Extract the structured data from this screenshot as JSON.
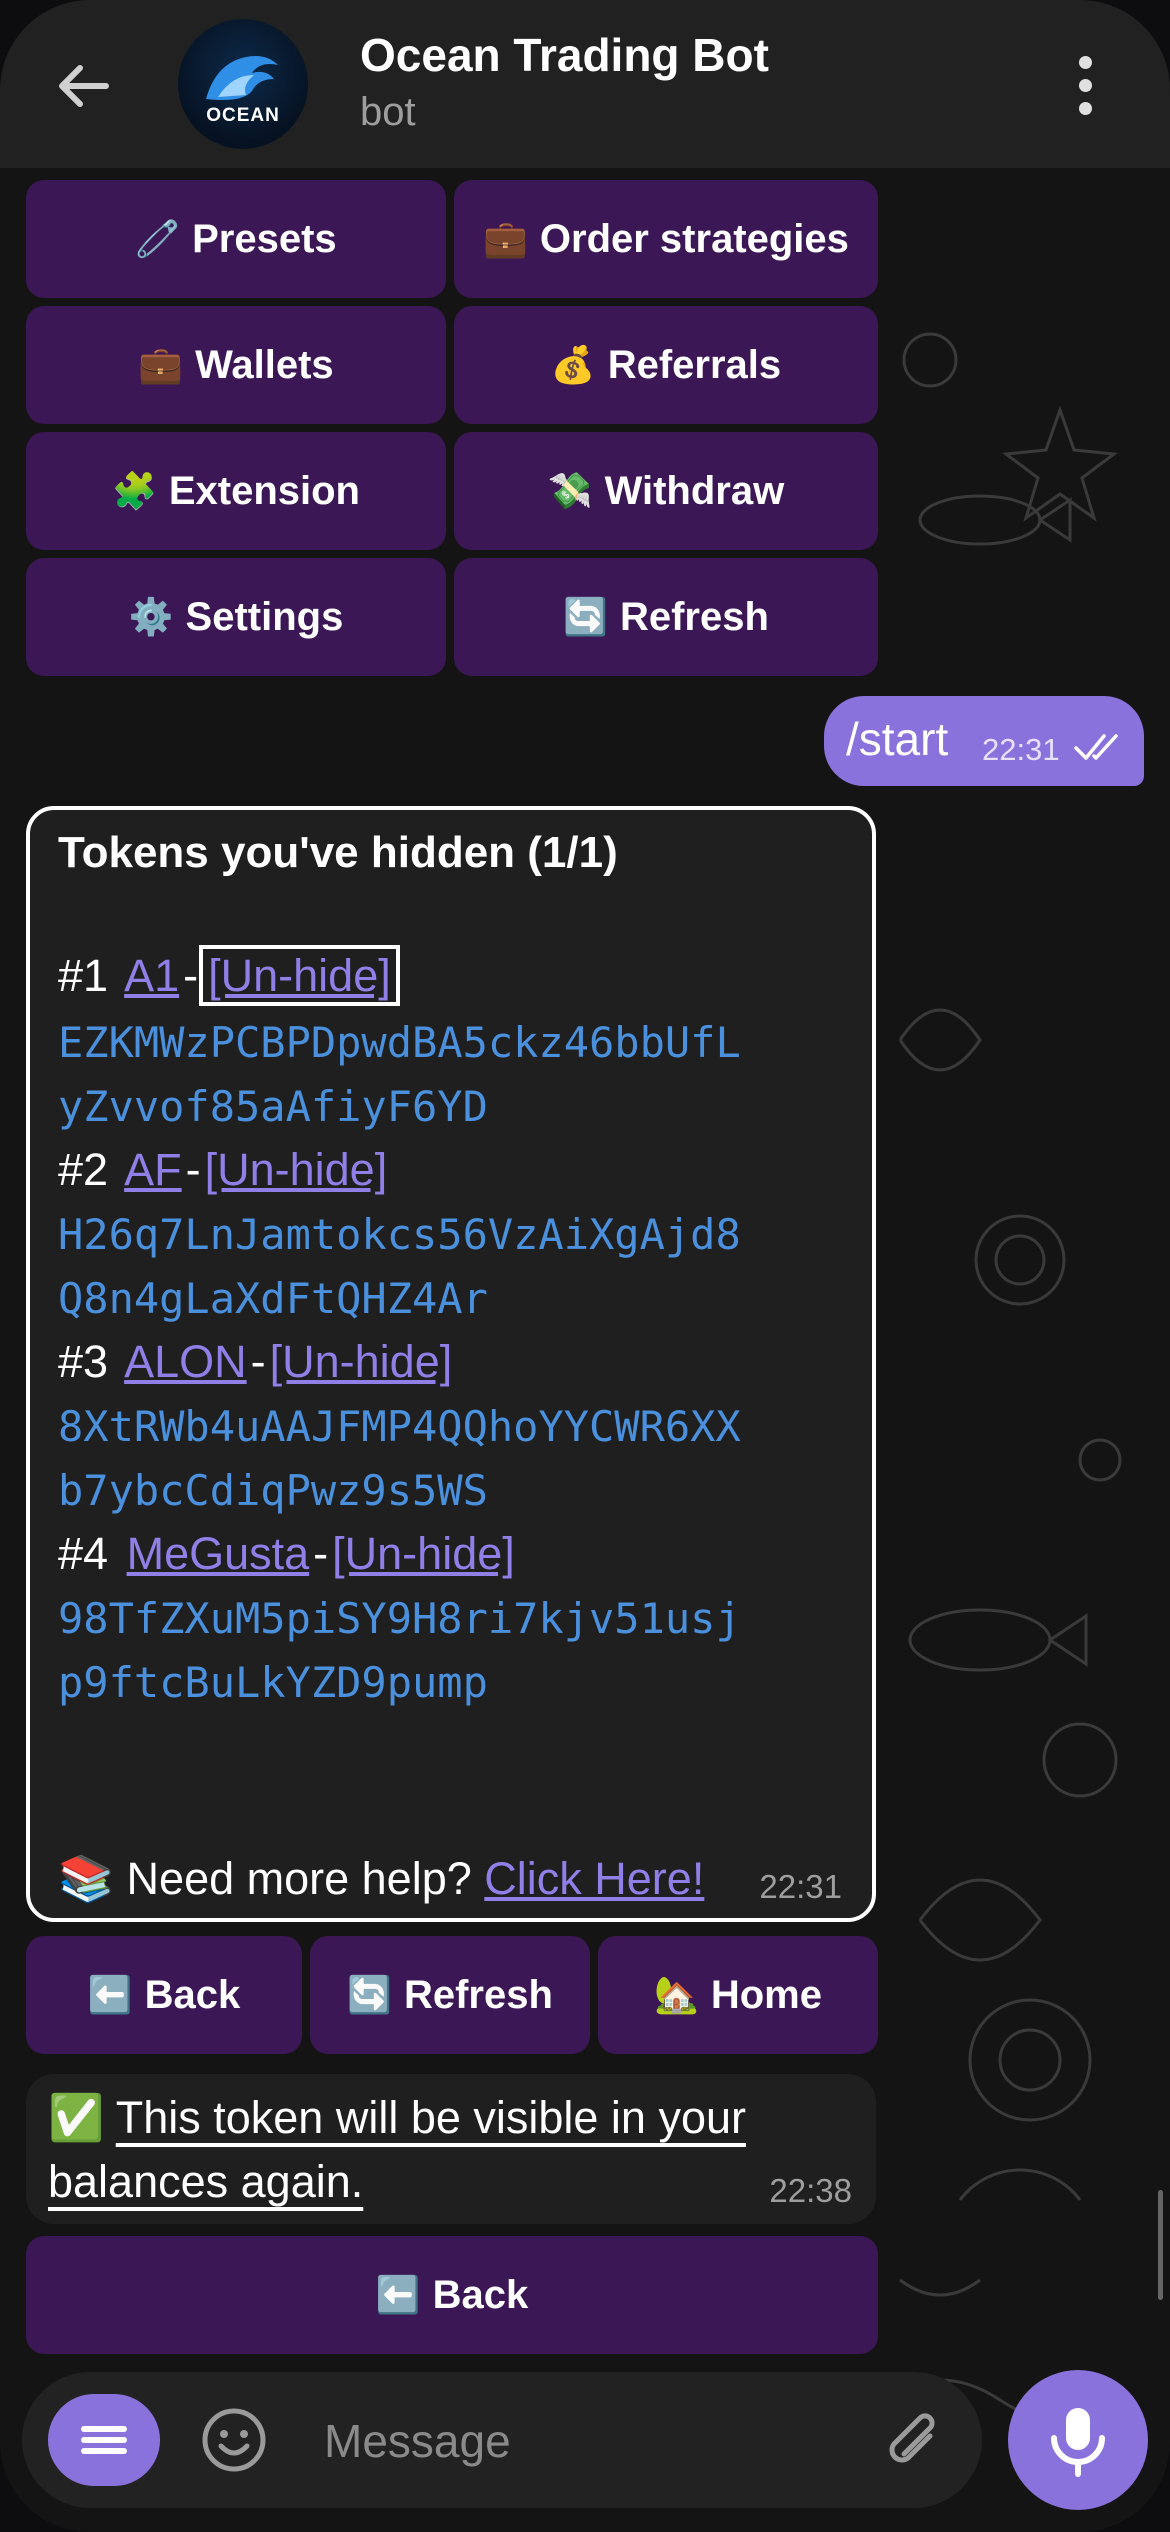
{
  "header": {
    "title": "Ocean Trading Bot",
    "subtitle": "bot",
    "avatar_text": "OCEAN"
  },
  "keyboard_top": [
    {
      "emoji": "🧷",
      "label": "Presets"
    },
    {
      "emoji": "💼",
      "label": "Order strategies"
    },
    {
      "emoji": "💼",
      "label": "Wallets"
    },
    {
      "emoji": "💰",
      "label": "Referrals"
    },
    {
      "emoji": "🧩",
      "label": "Extension"
    },
    {
      "emoji": "💸",
      "label": "Withdraw"
    },
    {
      "emoji": "⚙️",
      "label": "Settings"
    },
    {
      "emoji": "🔄",
      "label": "Refresh"
    }
  ],
  "outgoing": {
    "text": "/start",
    "time": "22:31"
  },
  "hidden_tokens_message": {
    "title": "Tokens you've hidden (1/1)",
    "tokens": [
      {
        "num": "#1",
        "name": "A1",
        "action": "[Un-hide]",
        "address_line1": "EZKMWzPCBPDpwdBA5ckz46bbUfL",
        "address_line2": "yZvvof85aAfiyF6YD"
      },
      {
        "num": "#2",
        "name": "AF",
        "action": "[Un-hide]",
        "address_line1": "H26q7LnJamtokcs56VzAiXgAjd8",
        "address_line2": "Q8n4gLaXdFtQHZ4Ar"
      },
      {
        "num": "#3",
        "name": "ALON",
        "action": "[Un-hide]",
        "address_line1": "8XtRWb4uAAJFMP4QQhoYYCWR6XX",
        "address_line2": "b7ybcCdiqPwz9s5WS"
      },
      {
        "num": "#4",
        "name": "MeGusta",
        "action": "[Un-hide]",
        "address_line1": "98TfZXuM5piSY9H8ri7kjv51usj",
        "address_line2": "p9ftcBuLkYZD9pump"
      }
    ],
    "dash": "-",
    "help_emoji": "📚",
    "help_text": "Need more help?",
    "help_link": "Click Here!",
    "time": "22:31"
  },
  "keyboard_mid": [
    {
      "emoji": "⬅️",
      "label": "Back"
    },
    {
      "emoji": "🔄",
      "label": "Refresh"
    },
    {
      "emoji": "🏡",
      "label": "Home"
    }
  ],
  "success_message": {
    "emoji": "✅",
    "text": "This token will be visible in your balances again.",
    "time": "22:38"
  },
  "keyboard_bottom": {
    "emoji": "⬅️",
    "label": "Back"
  },
  "input": {
    "placeholder": "Message"
  },
  "colors": {
    "accent": "#8a72dc",
    "button_bg": "#46196a",
    "link": "#8f7fe6",
    "address": "#4a90dd"
  }
}
